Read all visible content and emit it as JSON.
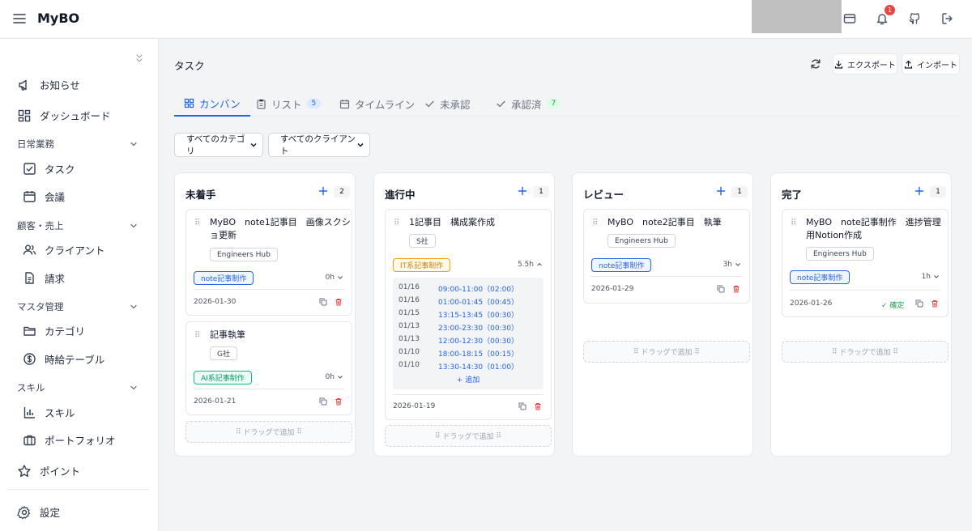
{
  "app": {
    "title": "MyBO",
    "notification_count": "1"
  },
  "header": {
    "icons": [
      "menu-icon",
      "card-icon",
      "bell-icon",
      "github-icon",
      "logout-icon"
    ]
  },
  "sidebar": {
    "items_top": [
      {
        "label": "お知らせ",
        "icon": "megaphone-icon"
      },
      {
        "label": "ダッシュボード",
        "icon": "dashboard-icon"
      }
    ],
    "sections": [
      {
        "label": "日常業務",
        "items": [
          {
            "label": "タスク",
            "icon": "checkbox-icon"
          },
          {
            "label": "会議",
            "icon": "calendar-icon"
          }
        ]
      },
      {
        "label": "顧客・売上",
        "items": [
          {
            "label": "クライアント",
            "icon": "users-icon"
          },
          {
            "label": "請求",
            "icon": "document-icon"
          }
        ]
      },
      {
        "label": "マスタ管理",
        "items": [
          {
            "label": "カテゴリ",
            "icon": "folder-icon"
          },
          {
            "label": "時給テーブル",
            "icon": "dollar-icon"
          }
        ]
      },
      {
        "label": "スキル",
        "items": [
          {
            "label": "スキル",
            "icon": "bar-chart-icon"
          },
          {
            "label": "ポートフォリオ",
            "icon": "briefcase-icon"
          }
        ]
      }
    ],
    "points": {
      "label": "ポイント",
      "icon": "star-icon"
    },
    "settings": {
      "label": "設定",
      "icon": "gear-icon"
    }
  },
  "page": {
    "title": "タスク",
    "export_label": "エクスポート",
    "import_label": "インポート"
  },
  "tabs": [
    {
      "label": "カンバン",
      "icon": "grid-icon",
      "count": ""
    },
    {
      "label": "リスト",
      "icon": "clipboard-icon",
      "count": "5"
    },
    {
      "label": "タイムライン",
      "icon": "calendar-icon",
      "count": ""
    },
    {
      "label": "未承認",
      "icon": "check-icon",
      "count": ""
    },
    {
      "label": "承認済",
      "icon": "check-icon",
      "count": "7"
    }
  ],
  "filters": {
    "category": "すべてのカテゴリ",
    "client": "すべてのクライアント"
  },
  "drop_label": "ドラッグで追加",
  "columns": [
    {
      "title": "未着手",
      "count": "2",
      "cards": [
        {
          "title": "MyBO　note1記事目　画像スクショ更新",
          "client": "Engineers Hub",
          "category": "note記事制作",
          "hours": "0h",
          "date": "2026-01-30"
        },
        {
          "title": "記事執筆",
          "client": "G社",
          "category": "AI系記事制作",
          "hours": "0h",
          "date": "2026-01-21"
        }
      ]
    },
    {
      "title": "進行中",
      "count": "1",
      "cards": [
        {
          "title": "1記事目　構成案作成",
          "client": "S社",
          "category": "IT系記事制作",
          "hours": "5.5h",
          "date": "2026-01-19",
          "time_entries": [
            {
              "date": "01/16",
              "time": "09:00-11:00（02:00）"
            },
            {
              "date": "01/16",
              "time": "01:00-01:45（00:45）"
            },
            {
              "date": "01/15",
              "time": "13:15-13:45（00:30）"
            },
            {
              "date": "01/13",
              "time": "23:00-23:30（00:30）"
            },
            {
              "date": "01/13",
              "time": "12:00-12:30（00:30）"
            },
            {
              "date": "01/10",
              "time": "18:00-18:15（00:15）"
            },
            {
              "date": "01/10",
              "time": "13:30-14:30（01:00）"
            }
          ],
          "add_label": "+ 追加"
        }
      ]
    },
    {
      "title": "レビュー",
      "count": "1",
      "cards": [
        {
          "title": "MyBO　note2記事目　執筆",
          "client": "Engineers Hub",
          "category": "note記事制作",
          "hours": "3h",
          "date": "2026-01-29"
        }
      ]
    },
    {
      "title": "完了",
      "count": "1",
      "cards": [
        {
          "title": "MyBO　note記事制作　進捗管理用Notion作成",
          "client": "Engineers Hub",
          "category": "note記事制作",
          "hours": "1h",
          "date": "2026-01-26",
          "confirm_label": "✓ 確定"
        }
      ]
    }
  ],
  "colors": {
    "accent": "#2563eb",
    "danger": "#ef4444",
    "success": "#16a34a",
    "warning": "#d97706"
  }
}
